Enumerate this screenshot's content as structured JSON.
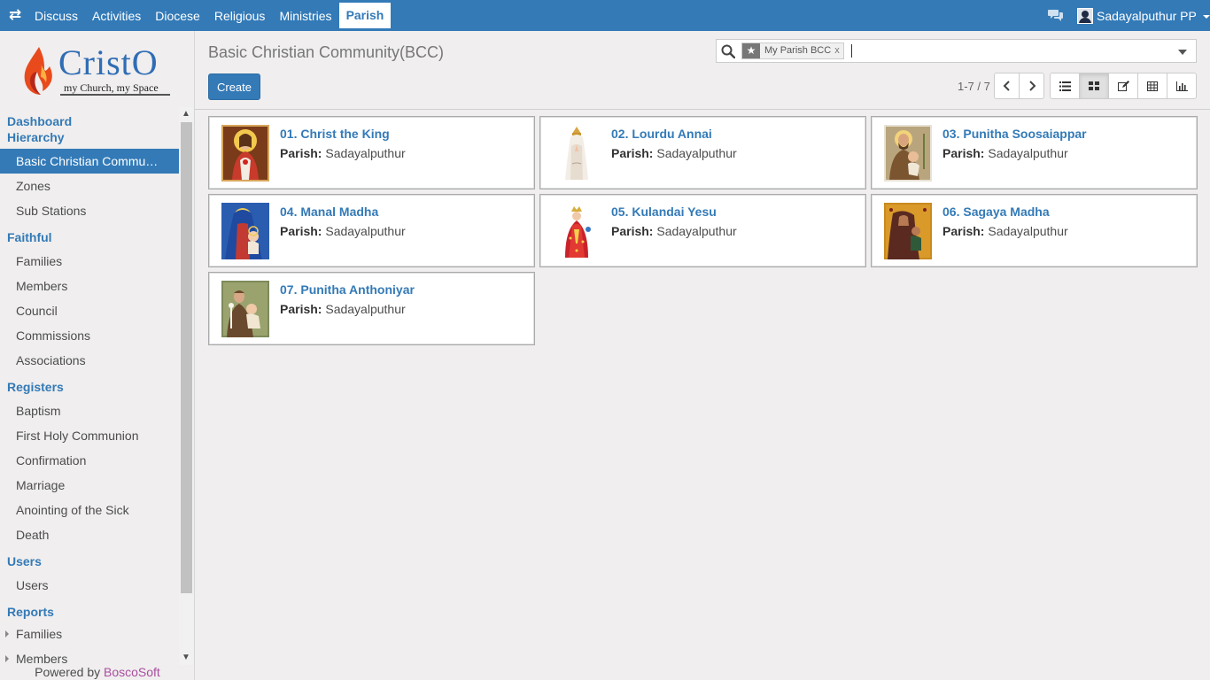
{
  "topbar": {
    "menus": [
      "Discuss",
      "Activities",
      "Diocese",
      "Religious",
      "Ministries",
      "Parish"
    ],
    "active_menu": "Parish",
    "user_name": "Sadayalputhur PP"
  },
  "logo": {
    "brand": "CristO",
    "tagline": "my Church, my Space"
  },
  "sidebar": {
    "sections": [
      {
        "title": "Dashboard",
        "items": []
      },
      {
        "title": "Hierarchy",
        "items": [
          "Basic Christian Commu…",
          "Zones",
          "Sub Stations"
        ]
      },
      {
        "title": "Faithful",
        "items": [
          "Families",
          "Members",
          "Council",
          "Commissions",
          "Associations"
        ]
      },
      {
        "title": "Registers",
        "items": [
          "Baptism",
          "First Holy Communion",
          "Confirmation",
          "Marriage",
          "Anointing of the Sick",
          "Death"
        ]
      },
      {
        "title": "Users",
        "items": [
          "Users"
        ]
      },
      {
        "title": "Reports",
        "items": [
          "Families",
          "Members"
        ]
      }
    ],
    "active_item": "Basic Christian Commu…",
    "powered_prefix": "Powered by",
    "powered_brand": "BoscoSoft"
  },
  "main": {
    "title": "Basic Christian Community(BCC)",
    "create_label": "Create",
    "search": {
      "facet_value": "My Parish BCC",
      "facet_remove": "x"
    },
    "pager": "1-7 / 7",
    "views": [
      "list-view-icon",
      "kanban-view-icon",
      "form-view-icon",
      "grid-view-icon",
      "graph-view-icon"
    ],
    "active_view": "kanban-view-icon"
  },
  "records": [
    {
      "name": "01. Christ the King",
      "parish_label": "Parish:",
      "parish": "Sadayalputhur",
      "image": "christ-the-king-image"
    },
    {
      "name": "02. Lourdu Annai",
      "parish_label": "Parish:",
      "parish": "Sadayalputhur",
      "image": "lourdu-annai-image"
    },
    {
      "name": "03. Punitha Soosaiappar",
      "parish_label": "Parish:",
      "parish": "Sadayalputhur",
      "image": "punitha-soosaiappar-image"
    },
    {
      "name": "04. Manal Madha",
      "parish_label": "Parish:",
      "parish": "Sadayalputhur",
      "image": "manal-madha-image"
    },
    {
      "name": "05. Kulandai Yesu",
      "parish_label": "Parish:",
      "parish": "Sadayalputhur",
      "image": "kulandai-yesu-image"
    },
    {
      "name": "06. Sagaya Madha",
      "parish_label": "Parish:",
      "parish": "Sadayalputhur",
      "image": "sagaya-madha-image"
    },
    {
      "name": "07. Punitha Anthoniyar",
      "parish_label": "Parish:",
      "parish": "Sadayalputhur",
      "image": "punitha-anthoniyar-image"
    }
  ],
  "colors": {
    "accent": "#337ab7",
    "brand_secondary": "#a94ea0"
  }
}
